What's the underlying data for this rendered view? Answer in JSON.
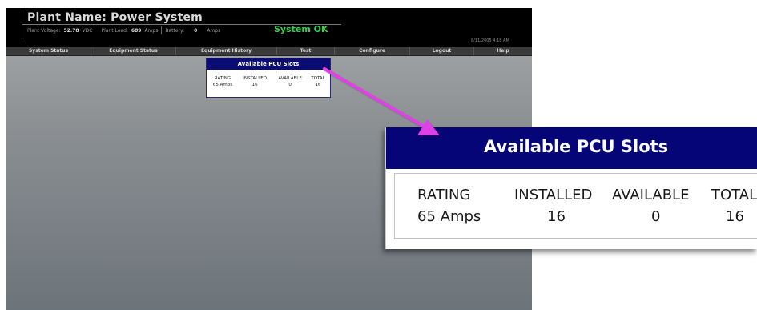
{
  "header": {
    "plant_title": "Plant Name: Power System",
    "voltage_label": "Plant Voltage:",
    "voltage_value": "52.78",
    "voltage_unit": "VDC",
    "load_label": "Plant Load:",
    "load_value": "689",
    "load_unit": "Amps",
    "battery_label": "Battery:",
    "battery_value": "0",
    "battery_unit": "Amps",
    "system_status": "System OK",
    "timestamp": "8/11/2005 4:18 AM"
  },
  "nav": {
    "items": [
      {
        "label": "System Status"
      },
      {
        "label": "Equipment Status"
      },
      {
        "label": "Equipment History"
      },
      {
        "label": "Test"
      },
      {
        "label": "Configure"
      },
      {
        "label": "Logout"
      },
      {
        "label": "Help"
      }
    ]
  },
  "pcu_panel": {
    "title": "Available PCU Slots",
    "columns": [
      "RATING",
      "INSTALLED",
      "AVAILABLE",
      "TOTAL"
    ],
    "row": [
      "65 Amps",
      "16",
      "0",
      "16"
    ]
  },
  "colors": {
    "header_bg": "#000000",
    "status_ok": "#35d04b",
    "panel_title_bg": "#050578",
    "arrow": "#e040e8"
  }
}
